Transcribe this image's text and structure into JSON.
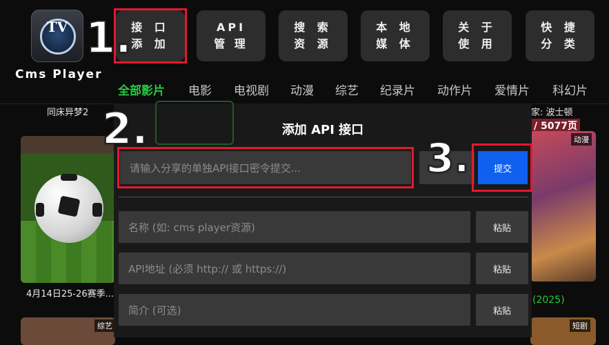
{
  "app": {
    "logo_text": "TV",
    "name": "Cms Player"
  },
  "top_buttons": [
    {
      "label": "接 口\n添 加"
    },
    {
      "label": "API\n管 理"
    },
    {
      "label": "搜 索\n资 源"
    },
    {
      "label": "本 地\n媒 体"
    },
    {
      "label": "关 于\n使 用"
    },
    {
      "label": "快 捷\n分 类"
    }
  ],
  "steps": [
    "1.",
    "2.",
    "3."
  ],
  "categories": [
    "全部影片",
    "电影",
    "电视剧",
    "动漫",
    "综艺",
    "纪录片",
    "动作片",
    "爱情片",
    "科幻片"
  ],
  "background": {
    "title_left": "同床异梦2",
    "title_right": "家: 波士顿",
    "pages": "/ 5077页",
    "poster_left_caption": "4月14日25-26赛季...",
    "poster_right_badge": "动漫",
    "poster_right_caption": "(2025)",
    "bottom_left_badge": "综艺",
    "bottom_right_badge": "短剧"
  },
  "dialog": {
    "title": "添加 API 接口",
    "command_placeholder": "请输入分享的单独API接口密令提交...",
    "submit_label": "提交",
    "name_placeholder": "名称 (如: cms player资源)",
    "url_placeholder": "API地址 (必须 http:// 或 https://)",
    "desc_placeholder": "简介 (可选)",
    "paste_label": "粘贴"
  },
  "colors": {
    "accent_green": "#27c93f",
    "highlight_red": "#e5182f",
    "submit_blue": "#1060f0"
  }
}
